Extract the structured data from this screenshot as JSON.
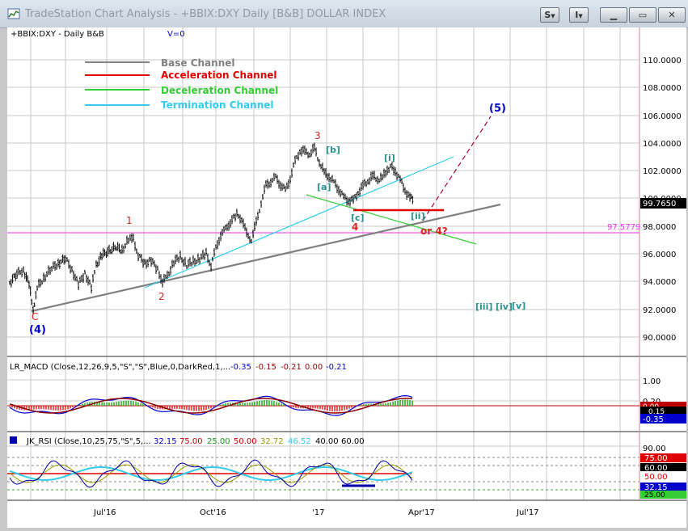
{
  "window": {
    "title": "TradeStation Chart Analysis - +BBIX:DXY Daily [B&B] DOLLAR INDEX",
    "btn_s": "S",
    "btn_i": "I"
  },
  "colors": {
    "base_channel": "#808080",
    "acceleration_channel": "#e00000",
    "deceleration_channel": "#33cc33",
    "termination_channel": "#33ccee",
    "wave_label_red": "#dd2222",
    "wave_label_blue": "#0000cc",
    "wave_label_teal": "#2a9090",
    "target_line": "#aa0033",
    "magenta_level": "#ee33ee"
  },
  "price_panel": {
    "header": "+BBIX:DXY - Daily  B&B",
    "header_extra": "V=0",
    "legend": [
      {
        "label": "Base Channel",
        "color": "#808080"
      },
      {
        "label": "Acceleration Channel",
        "color": "#e00000"
      },
      {
        "label": "Deceleration Channel",
        "color": "#33cc33"
      },
      {
        "label": "Termination Channel",
        "color": "#33ccee"
      }
    ],
    "y_ticks": [
      "110.0000",
      "108.0000",
      "106.0000",
      "104.0000",
      "102.0000",
      "100.0000",
      "98.0000",
      "96.0000",
      "94.0000",
      "92.0000",
      "90.0000"
    ],
    "last_price": "99.7650",
    "magenta_level_label": "97.5779",
    "wave_labels": {
      "c_low": "C",
      "w4_low": "(4)",
      "w1": "1",
      "w2": "2",
      "w3": "3",
      "w4": "4",
      "w4b": "or 4?",
      "w5": "(5)",
      "a": "[a]",
      "b": "[b]",
      "c": "[c]",
      "i": "[i]",
      "ii": "[ii]",
      "iii": "[iii]",
      "iv": "[iv]",
      "v": "[v]"
    }
  },
  "macd_panel": {
    "header": "LR_MACD (Close,12,26,9,5,\"S\",\"S\",Blue,0,DarkRed,1,...",
    "values": [
      "-0.35",
      "-0.15",
      "-0.21",
      "0.00",
      "-0.21"
    ],
    "y_ticks": [
      "1.00",
      "0.20"
    ],
    "flag_values": [
      "0.15",
      "-0.35"
    ],
    "zero_tag": "0.00"
  },
  "rsi_panel": {
    "header": "JK_RSI (Close,10,25,75,\"S\",5,...",
    "values": [
      "32.15",
      "75.00",
      "25.00",
      "50.00",
      "32.72",
      "46.52",
      "40.00",
      "60.00"
    ],
    "y_ticks": [
      "90.00"
    ],
    "flag_values": [
      "75.00",
      "60.00",
      "50.00",
      "32.15",
      "25.00"
    ]
  },
  "x_axis": {
    "labels": [
      "Jul'16",
      "Oct'16",
      "'17",
      "Apr'17",
      "Jul'17"
    ]
  }
}
